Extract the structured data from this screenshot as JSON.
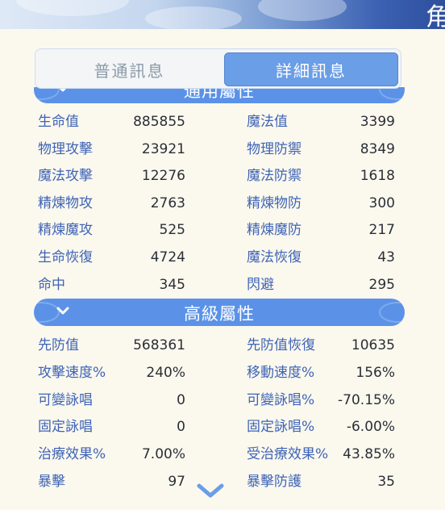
{
  "header": {
    "title_fragment": "角"
  },
  "tabs": [
    {
      "label": "普通訊息",
      "active": false
    },
    {
      "label": "詳細訊息",
      "active": true
    }
  ],
  "sections": {
    "general": {
      "title": "通用屬性",
      "rows": [
        {
          "left_label": "生命值",
          "left_value": "885855",
          "right_label": "魔法值",
          "right_value": "3399"
        },
        {
          "left_label": "物理攻擊",
          "left_value": "23921",
          "right_label": "物理防禦",
          "right_value": "8349"
        },
        {
          "left_label": "魔法攻擊",
          "left_value": "12276",
          "right_label": "魔法防禦",
          "right_value": "1618"
        },
        {
          "left_label": "精煉物攻",
          "left_value": "2763",
          "right_label": "精煉物防",
          "right_value": "300"
        },
        {
          "left_label": "精煉魔攻",
          "left_value": "525",
          "right_label": "精煉魔防",
          "right_value": "217"
        },
        {
          "left_label": "生命恢復",
          "left_value": "4724",
          "right_label": "魔法恢復",
          "right_value": "43"
        },
        {
          "left_label": "命中",
          "left_value": "345",
          "right_label": "閃避",
          "right_value": "295"
        }
      ]
    },
    "advanced": {
      "title": "高級屬性",
      "rows": [
        {
          "left_label": "先防值",
          "left_value": "568361",
          "right_label": "先防值恢復",
          "right_value": "10635"
        },
        {
          "left_label": "攻擊速度%",
          "left_value": "240%",
          "right_label": "移動速度%",
          "right_value": "156%"
        },
        {
          "left_label": "可變詠唱",
          "left_value": "0",
          "right_label": "可變詠唱%",
          "right_value": "-70.15%"
        },
        {
          "left_label": "固定詠唱",
          "left_value": "0",
          "right_label": "固定詠唱%",
          "right_value": "-6.00%"
        },
        {
          "left_label": "治療效果%",
          "left_value": "7.00%",
          "right_label": "受治療效果%",
          "right_value": "43.85%"
        },
        {
          "left_label": "暴擊",
          "left_value": "97",
          "right_label": "暴擊防護",
          "right_value": "35"
        }
      ]
    }
  },
  "colors": {
    "accent": "#5b92e8",
    "label": "#3e64b6",
    "value": "#2a2f36",
    "background": "#fbf8ee"
  },
  "icons": {
    "section_toggle": "chevron-down-icon",
    "scroll_more": "chevron-down-icon"
  }
}
